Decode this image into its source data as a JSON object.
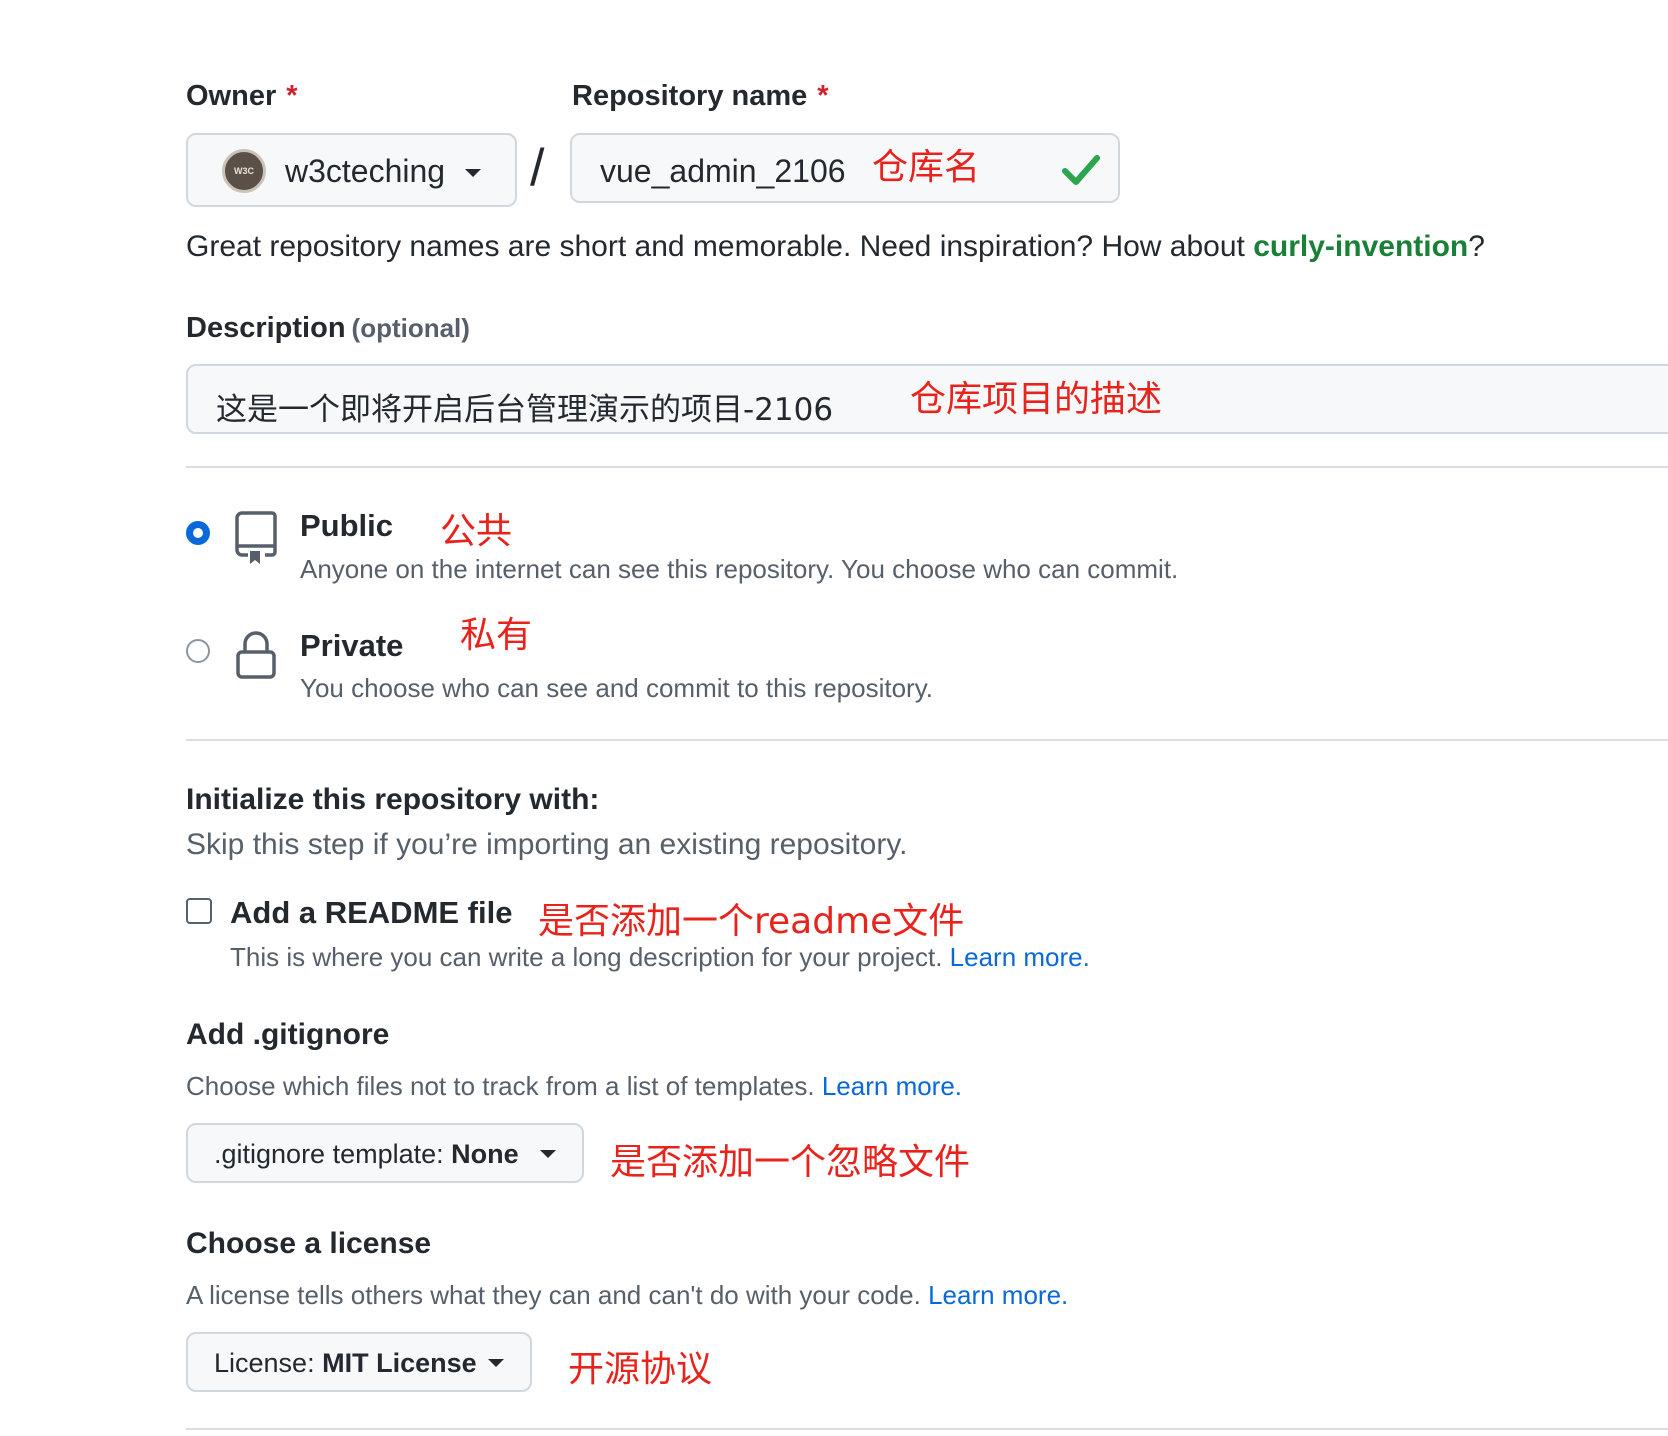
{
  "owner": {
    "label": "Owner",
    "required_mark": "*",
    "value": "w3cteching",
    "avatar_text": "W3C"
  },
  "separator": "/",
  "repo": {
    "label": "Repository name",
    "required_mark": "*",
    "value": "vue_admin_2106",
    "annotation": "仓库名"
  },
  "hint": {
    "text": "Great repository names are short and memorable. Need inspiration? How about ",
    "suggestion": "curly-invention",
    "suffix": "?"
  },
  "description": {
    "label": "Description",
    "optional": "(optional)",
    "value": "这是一个即将开启后台管理演示的项目-2106",
    "annotation": "仓库项目的描述"
  },
  "visibility": {
    "public": {
      "title": "Public",
      "desc": "Anyone on the internet can see this repository. You choose who can commit.",
      "annotation": "公共",
      "selected": true
    },
    "private": {
      "title": "Private",
      "desc": "You choose who can see and commit to this repository.",
      "annotation": "私有",
      "selected": false
    }
  },
  "init": {
    "title": "Initialize this repository with:",
    "subtitle": "Skip this step if you’re importing an existing repository.",
    "readme": {
      "label": "Add a README file",
      "annotation": "是否添加一个readme文件",
      "desc": "This is where you can write a long description for your project.",
      "learn_more": "Learn more.",
      "checked": false
    }
  },
  "gitignore": {
    "title": "Add .gitignore",
    "desc": "Choose which files not to track from a list of templates.",
    "learn_more": "Learn more.",
    "select_prefix": ".gitignore template:",
    "select_value": "None",
    "annotation": "是否添加一个忽略文件"
  },
  "license": {
    "title": "Choose a license",
    "desc": "A license tells others what they can and can't do with your code.",
    "learn_more": "Learn more.",
    "select_prefix": "License:",
    "select_value": "MIT License",
    "annotation": "开源协议"
  },
  "colors": {
    "accent": "#0969da",
    "success": "#1a7f37",
    "required": "#cf222e",
    "annotation": "#e8231c"
  },
  "icons": [
    "avatar",
    "caret-down-icon",
    "check-icon",
    "repo-icon",
    "lock-icon"
  ]
}
